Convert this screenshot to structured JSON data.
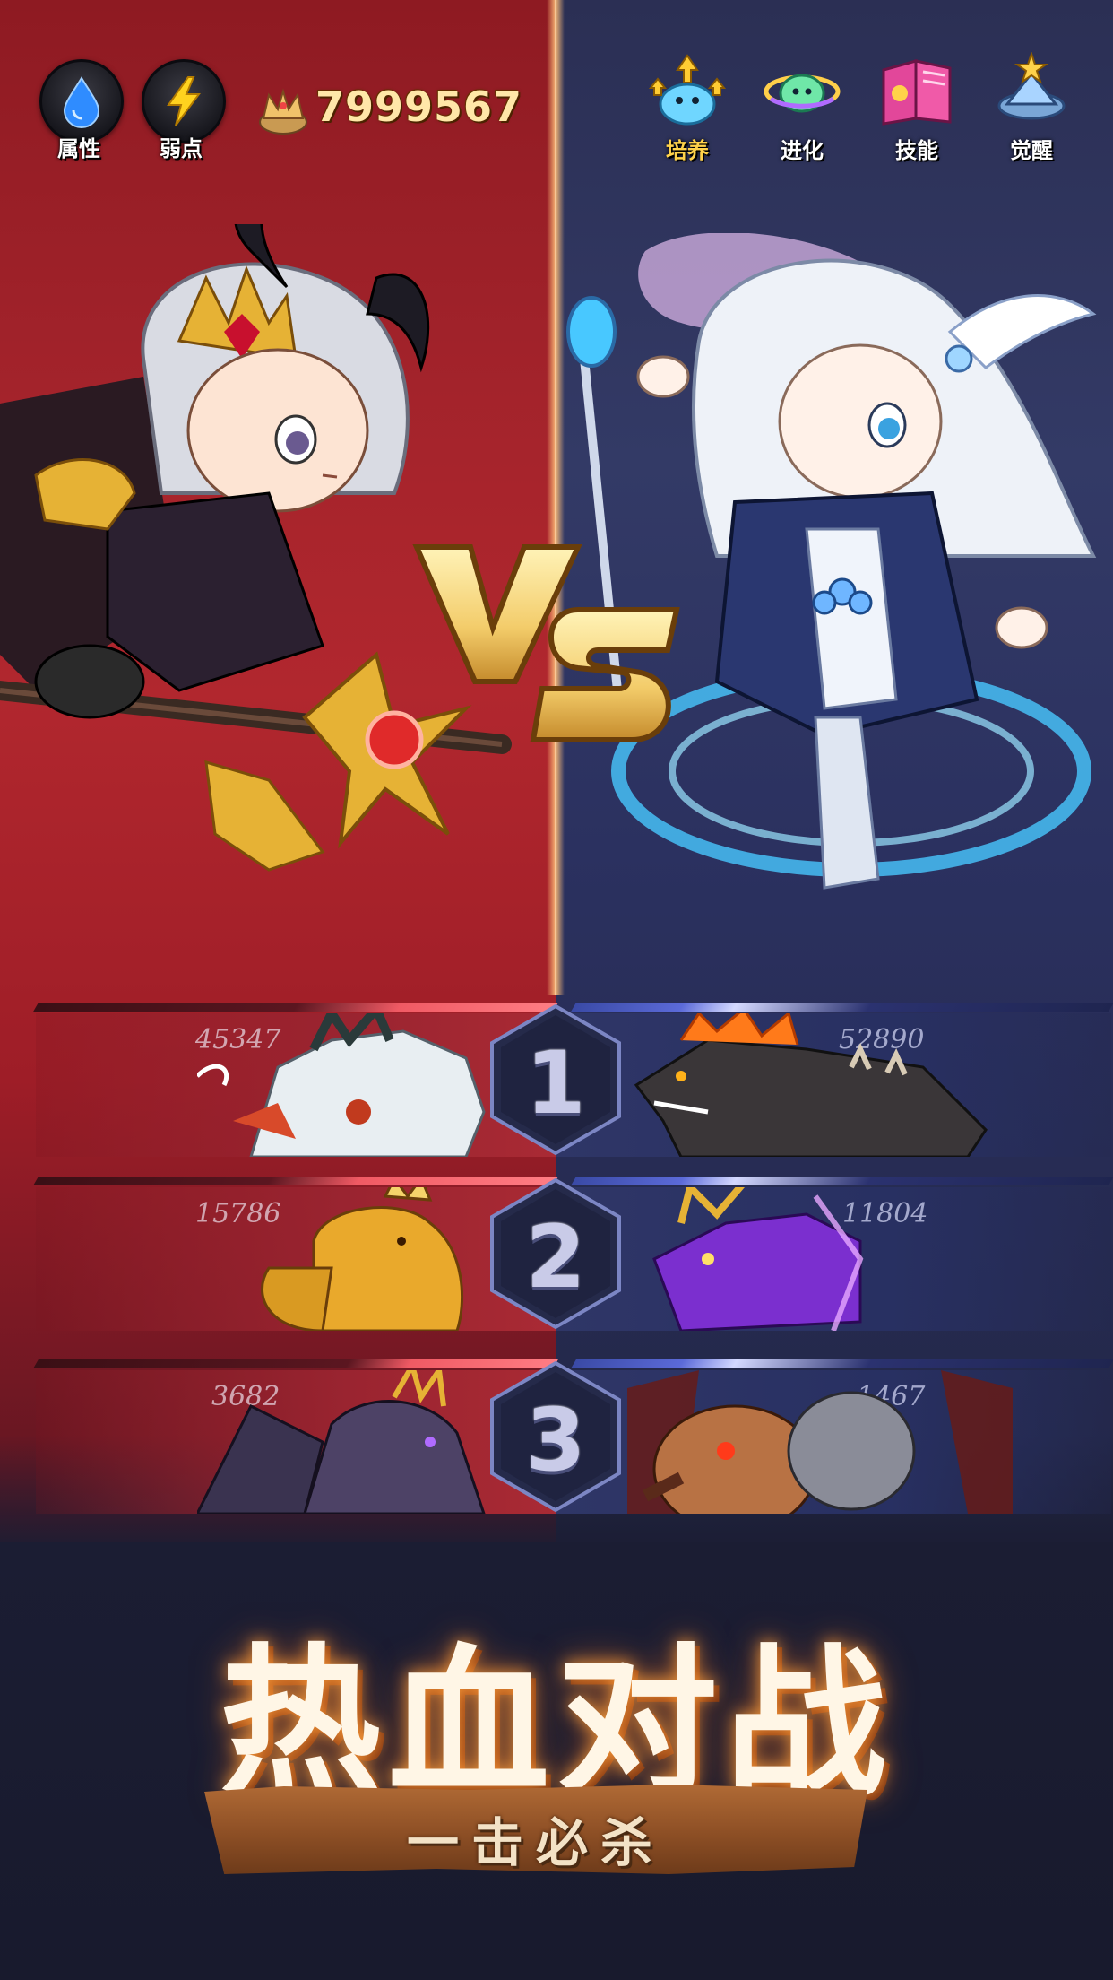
{
  "hud": {
    "left_buttons": [
      {
        "label": "属性",
        "icon": "water-drop-icon"
      },
      {
        "label": "弱点",
        "icon": "lightning-icon"
      }
    ],
    "currency": {
      "icon": "crown-coin-icon",
      "value": "7999567"
    },
    "right_menu": [
      {
        "label": "培养",
        "icon": "slime-upgrade-icon",
        "active": true
      },
      {
        "label": "进化",
        "icon": "slime-evolve-icon",
        "active": false
      },
      {
        "label": "技能",
        "icon": "skill-book-icon",
        "active": false
      },
      {
        "label": "觉醒",
        "icon": "awaken-crystal-icon",
        "active": false
      }
    ]
  },
  "battle": {
    "vs_text": "VS",
    "matchups": [
      {
        "number": "1",
        "left_score": "45347",
        "right_score": "52890",
        "left_monster": "white-wolf-monster",
        "right_monster": "fire-hound-monster"
      },
      {
        "number": "2",
        "left_score": "15786",
        "right_score": "11804",
        "left_monster": "golden-lion-monster",
        "right_monster": "purple-dragon-monster"
      },
      {
        "number": "3",
        "left_score": "3682",
        "right_score": "1467",
        "left_monster": "dark-dragon-monster",
        "right_monster": "fire-ogre-monster"
      }
    ]
  },
  "promo": {
    "title": "热血对战",
    "subtitle": "一击必杀"
  },
  "colors": {
    "left_team": "#a3232b",
    "right_team": "#2f3667",
    "active_menu": "#ffd24a",
    "currency_text": "#ffe7a8"
  }
}
